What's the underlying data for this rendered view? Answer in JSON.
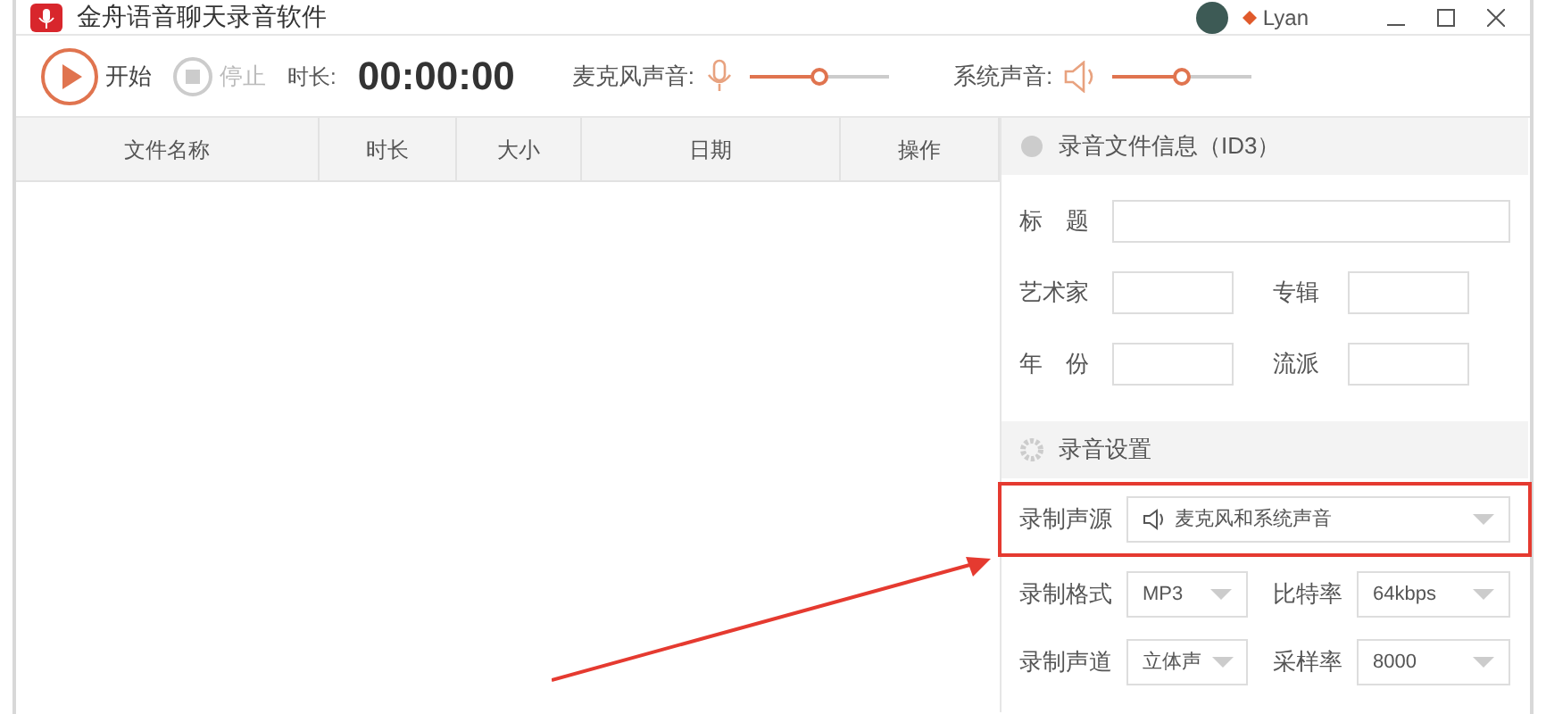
{
  "window": {
    "title": "金舟语音聊天录音软件",
    "user": "Lyan"
  },
  "toolbar": {
    "start": {
      "label": "开始",
      "disabled": false
    },
    "stop": {
      "label": "停止",
      "disabled": true
    },
    "duration_label": "时长:",
    "duration": "00:00:00",
    "mic": {
      "label": "麦克风声音:",
      "level": 0.5
    },
    "system": {
      "label": "系统声音:",
      "level": 0.5
    }
  },
  "table": {
    "columns": [
      "文件名称",
      "时长",
      "大小",
      "日期",
      "操作"
    ]
  },
  "id3": {
    "title": "录音文件信息（ID3）",
    "rows": [
      [
        {
          "label": "标　题"
        }
      ],
      [
        {
          "label": "艺术家"
        },
        {
          "label": "专辑"
        }
      ],
      [
        {
          "label": "年　份"
        },
        {
          "label": "流派"
        }
      ]
    ]
  },
  "settings": {
    "title": "录音设置",
    "source": {
      "label": "录制声源",
      "value": "麦克风和系统声音",
      "highlighted": true
    },
    "options": [
      {
        "label": "录制格式",
        "value": "MP3"
      },
      {
        "label": "比特率",
        "value": "64kbps"
      },
      {
        "label": "录制声道",
        "value": "立体声"
      },
      {
        "label": "采样率",
        "value": "8000"
      }
    ]
  }
}
